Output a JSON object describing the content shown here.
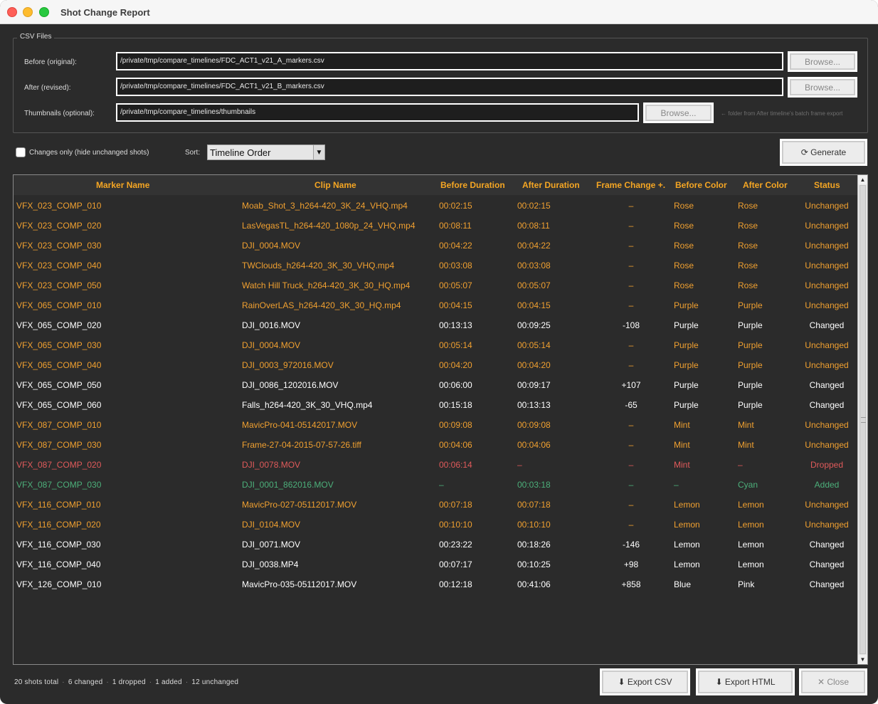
{
  "window": {
    "title": "Shot Change Report"
  },
  "csv_group": {
    "legend": "CSV Files",
    "rows": [
      {
        "label": "Before (original):",
        "value": "/private/tmp/compare_timelines/FDC_ACT1_v21_A_markers.csv",
        "browse": "Browse..."
      },
      {
        "label": "After (revised):",
        "value": "/private/tmp/compare_timelines/FDC_ACT1_v21_B_markers.csv",
        "browse": "Browse..."
      },
      {
        "label": "Thumbnails (optional):",
        "value": "/private/tmp/compare_timelines/thumbnails",
        "browse": "Browse..."
      }
    ],
    "hint": "← folder from After timeline's batch frame export"
  },
  "filters": {
    "changes_only_label": "Changes only (hide unchanged shots)",
    "changes_only_checked": false,
    "sort_label": "Sort:",
    "sort_value": "Timeline Order",
    "generate_label": "⟳  Generate"
  },
  "table": {
    "headers": [
      "Marker Name",
      "Clip Name",
      "Before Duration",
      "After Duration",
      "Frame Change +.",
      "Before Color",
      "After Color",
      "Status"
    ],
    "rows": [
      {
        "marker": "VFX_023_COMP_010",
        "clip": "Moab_Shot_3_h264-420_3K_24_VHQ.mp4",
        "before": "00:02:15",
        "after": "00:02:15",
        "change": "–",
        "bcolor": "Rose",
        "acolor": "Rose",
        "status": "Unchanged"
      },
      {
        "marker": "VFX_023_COMP_020",
        "clip": "LasVegasTL_h264-420_1080p_24_VHQ.mp4",
        "before": "00:08:11",
        "after": "00:08:11",
        "change": "–",
        "bcolor": "Rose",
        "acolor": "Rose",
        "status": "Unchanged"
      },
      {
        "marker": "VFX_023_COMP_030",
        "clip": "DJI_0004.MOV",
        "before": "00:04:22",
        "after": "00:04:22",
        "change": "–",
        "bcolor": "Rose",
        "acolor": "Rose",
        "status": "Unchanged"
      },
      {
        "marker": "VFX_023_COMP_040",
        "clip": "TWClouds_h264-420_3K_30_VHQ.mp4",
        "before": "00:03:08",
        "after": "00:03:08",
        "change": "–",
        "bcolor": "Rose",
        "acolor": "Rose",
        "status": "Unchanged"
      },
      {
        "marker": "VFX_023_COMP_050",
        "clip": "Watch Hill Truck_h264-420_3K_30_HQ.mp4",
        "before": "00:05:07",
        "after": "00:05:07",
        "change": "–",
        "bcolor": "Rose",
        "acolor": "Rose",
        "status": "Unchanged"
      },
      {
        "marker": "VFX_065_COMP_010",
        "clip": "RainOverLAS_h264-420_3K_30_HQ.mp4",
        "before": "00:04:15",
        "after": "00:04:15",
        "change": "–",
        "bcolor": "Purple",
        "acolor": "Purple",
        "status": "Unchanged"
      },
      {
        "marker": "VFX_065_COMP_020",
        "clip": "DJI_0016.MOV",
        "before": "00:13:13",
        "after": "00:09:25",
        "change": "-108",
        "bcolor": "Purple",
        "acolor": "Purple",
        "status": "Changed"
      },
      {
        "marker": "VFX_065_COMP_030",
        "clip": "DJI_0004.MOV",
        "before": "00:05:14",
        "after": "00:05:14",
        "change": "–",
        "bcolor": "Purple",
        "acolor": "Purple",
        "status": "Unchanged"
      },
      {
        "marker": "VFX_065_COMP_040",
        "clip": "DJI_0003_972016.MOV",
        "before": "00:04:20",
        "after": "00:04:20",
        "change": "–",
        "bcolor": "Purple",
        "acolor": "Purple",
        "status": "Unchanged"
      },
      {
        "marker": "VFX_065_COMP_050",
        "clip": "DJI_0086_1202016.MOV",
        "before": "00:06:00",
        "after": "00:09:17",
        "change": "+107",
        "bcolor": "Purple",
        "acolor": "Purple",
        "status": "Changed"
      },
      {
        "marker": "VFX_065_COMP_060",
        "clip": "Falls_h264-420_3K_30_VHQ.mp4",
        "before": "00:15:18",
        "after": "00:13:13",
        "change": "-65",
        "bcolor": "Purple",
        "acolor": "Purple",
        "status": "Changed"
      },
      {
        "marker": "VFX_087_COMP_010",
        "clip": "MavicPro-041-05142017.MOV",
        "before": "00:09:08",
        "after": "00:09:08",
        "change": "–",
        "bcolor": "Mint",
        "acolor": "Mint",
        "status": "Unchanged"
      },
      {
        "marker": "VFX_087_COMP_030",
        "clip": "Frame-27-04-2015-07-57-26.tiff",
        "before": "00:04:06",
        "after": "00:04:06",
        "change": "–",
        "bcolor": "Mint",
        "acolor": "Mint",
        "status": "Unchanged"
      },
      {
        "marker": "VFX_087_COMP_020",
        "clip": "DJI_0078.MOV",
        "before": "00:06:14",
        "after": "–",
        "change": "–",
        "bcolor": "Mint",
        "acolor": "–",
        "status": "Dropped"
      },
      {
        "marker": "VFX_087_COMP_030",
        "clip": "DJI_0001_862016.MOV",
        "before": "–",
        "after": "00:03:18",
        "change": "–",
        "bcolor": "–",
        "acolor": "Cyan",
        "status": "Added"
      },
      {
        "marker": "VFX_116_COMP_010",
        "clip": "MavicPro-027-05112017.MOV",
        "before": "00:07:18",
        "after": "00:07:18",
        "change": "–",
        "bcolor": "Lemon",
        "acolor": "Lemon",
        "status": "Unchanged"
      },
      {
        "marker": "VFX_116_COMP_020",
        "clip": "DJI_0104.MOV",
        "before": "00:10:10",
        "after": "00:10:10",
        "change": "–",
        "bcolor": "Lemon",
        "acolor": "Lemon",
        "status": "Unchanged"
      },
      {
        "marker": "VFX_116_COMP_030",
        "clip": "DJI_0071.MOV",
        "before": "00:23:22",
        "after": "00:18:26",
        "change": "-146",
        "bcolor": "Lemon",
        "acolor": "Lemon",
        "status": "Changed"
      },
      {
        "marker": "VFX_116_COMP_040",
        "clip": "DJI_0038.MP4",
        "before": "00:07:17",
        "after": "00:10:25",
        "change": "+98",
        "bcolor": "Lemon",
        "acolor": "Lemon",
        "status": "Changed"
      },
      {
        "marker": "VFX_126_COMP_010",
        "clip": "MavicPro-035-05112017.MOV",
        "before": "00:12:18",
        "after": "00:41:06",
        "change": "+858",
        "bcolor": "Blue",
        "acolor": "Pink",
        "status": "Changed"
      }
    ]
  },
  "status_colors": {
    "Unchanged": "#f0a030",
    "Changed": "#ffffff",
    "Dropped": "#e05a5a",
    "Added": "#4caf7a"
  },
  "footer": {
    "summary": [
      "20 shots total",
      "6 changed",
      "1 dropped",
      "1 added",
      "12 unchanged"
    ],
    "export_csv": "⬇ Export CSV",
    "export_html": "⬇ Export HTML",
    "close": "✕  Close"
  }
}
